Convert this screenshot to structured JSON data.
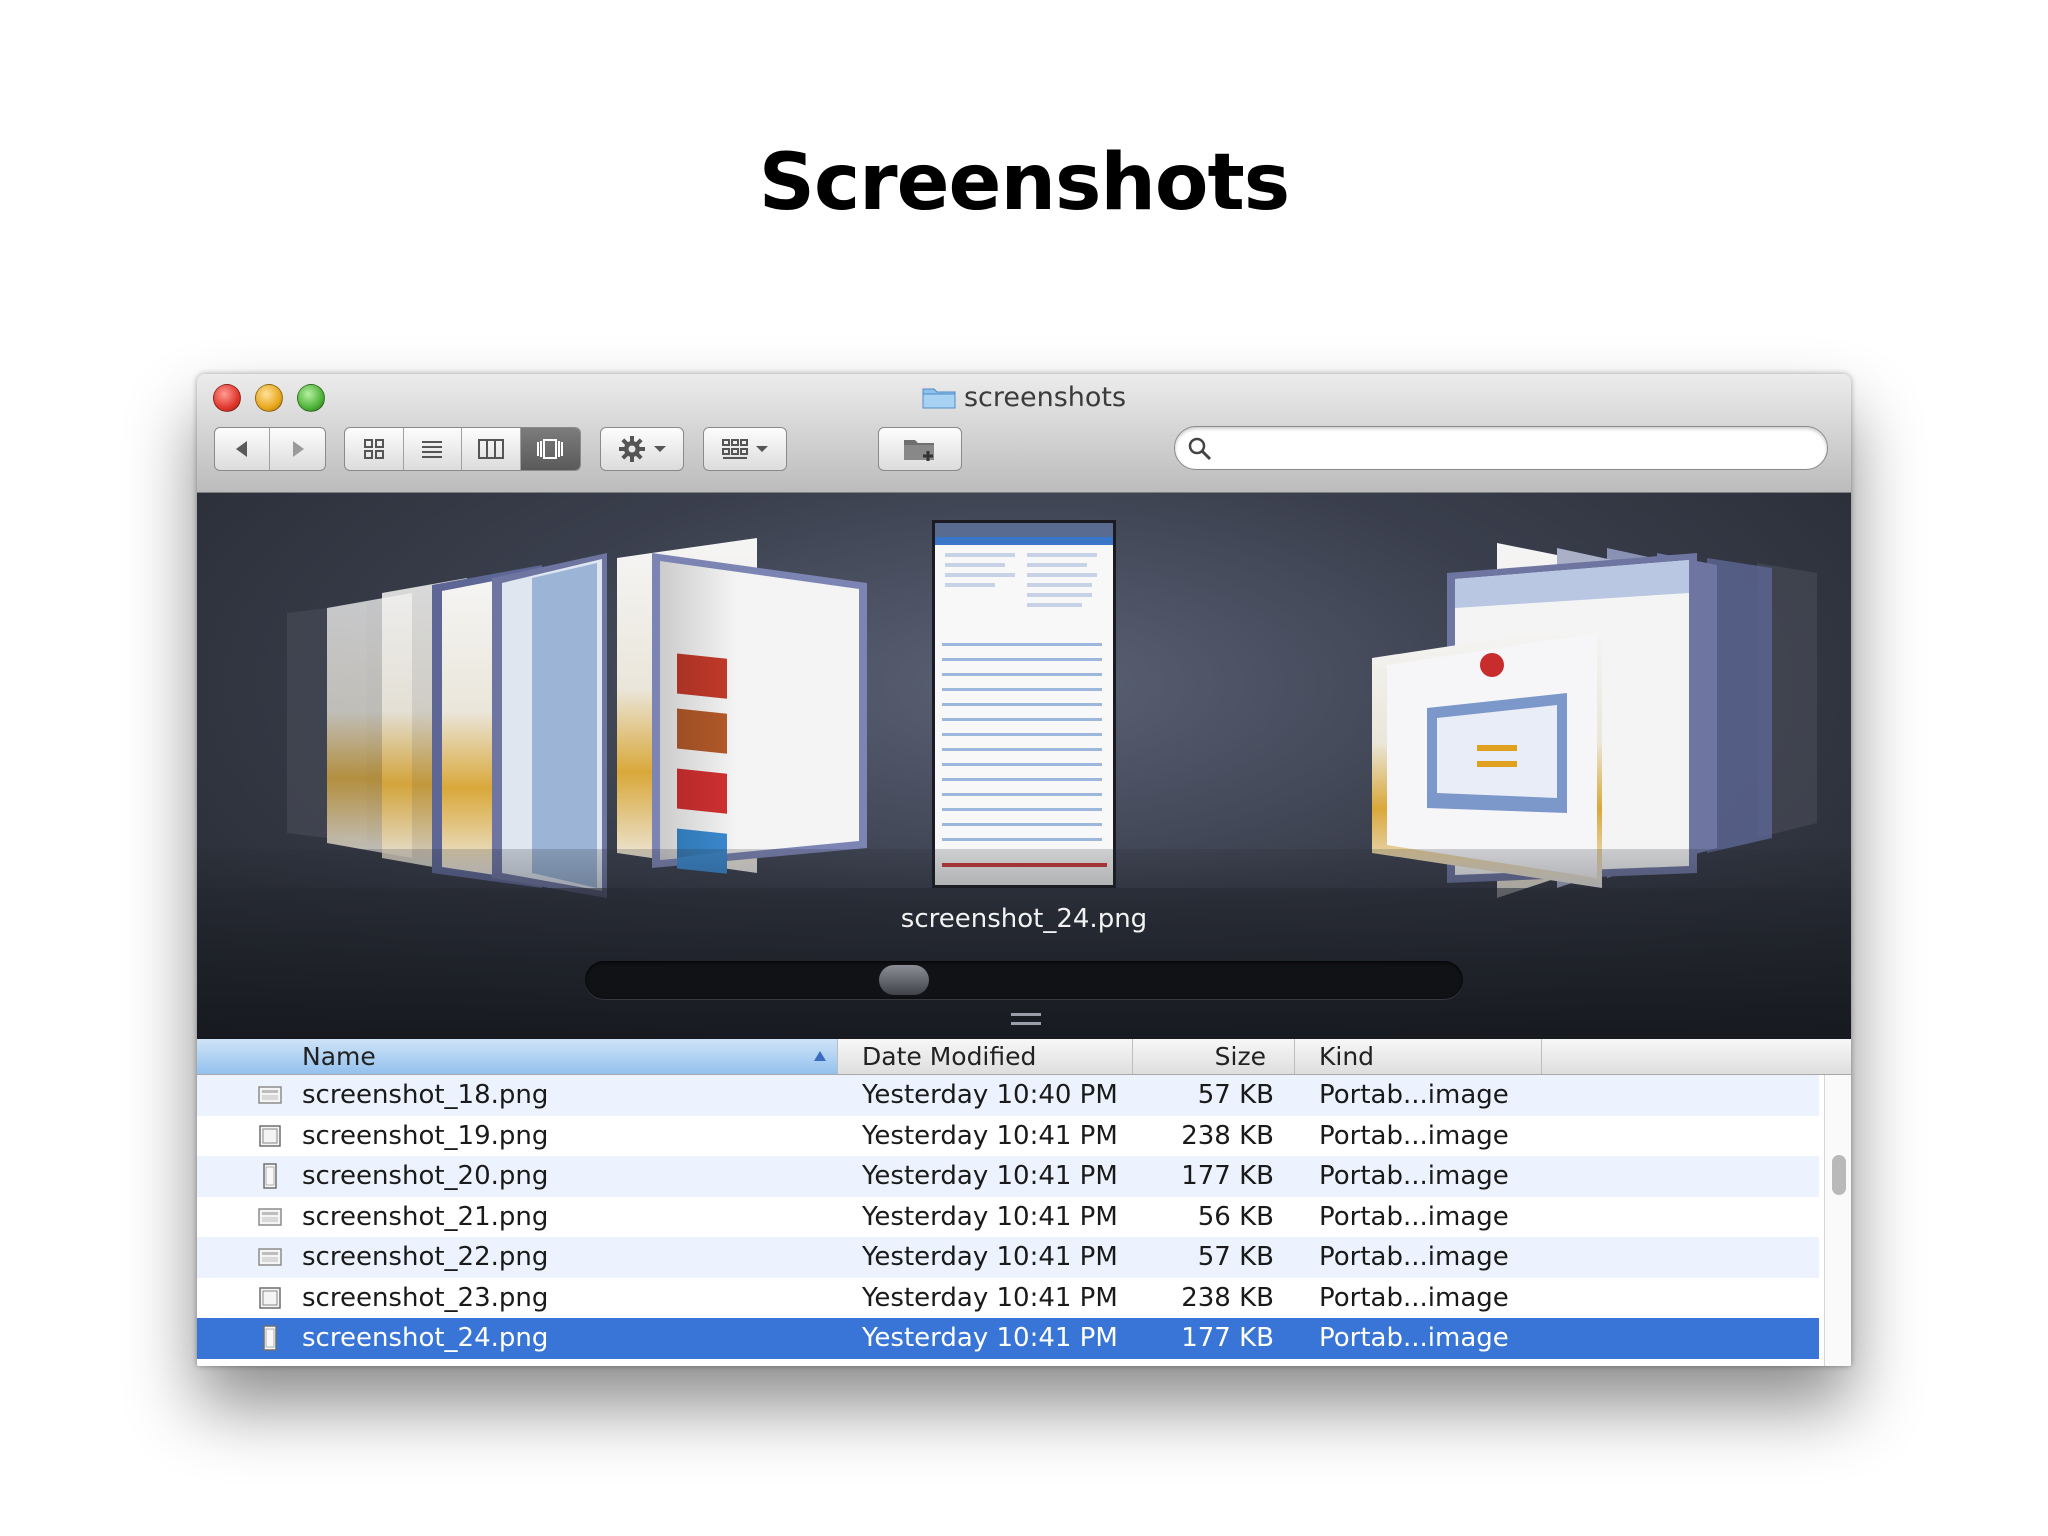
{
  "slide": {
    "title": "Screenshots"
  },
  "window": {
    "title": "screenshots",
    "search": {
      "value": "",
      "placeholder": ""
    }
  },
  "toolbar": {
    "view_modes": [
      "icon",
      "list",
      "column",
      "cover-flow"
    ],
    "active_view": "cover-flow"
  },
  "coverflow": {
    "selected_label": "screenshot_24.png",
    "scroll_position": 0.36
  },
  "columns": {
    "name": "Name",
    "date": "Date Modified",
    "size": "Size",
    "kind": "Kind",
    "sorted_by": "Name"
  },
  "files": [
    {
      "name": "screenshot_18.png",
      "date": "Yesterday 10:40 PM",
      "size": "57 KB",
      "kind": "Portab...image",
      "icon": "landscape-image-icon"
    },
    {
      "name": "screenshot_19.png",
      "date": "Yesterday 10:41 PM",
      "size": "238 KB",
      "kind": "Portab...image",
      "icon": "square-image-icon"
    },
    {
      "name": "screenshot_20.png",
      "date": "Yesterday 10:41 PM",
      "size": "177 KB",
      "kind": "Portab...image",
      "icon": "portrait-image-icon"
    },
    {
      "name": "screenshot_21.png",
      "date": "Yesterday 10:41 PM",
      "size": "56 KB",
      "kind": "Portab...image",
      "icon": "landscape-image-icon"
    },
    {
      "name": "screenshot_22.png",
      "date": "Yesterday 10:41 PM",
      "size": "57 KB",
      "kind": "Portab...image",
      "icon": "landscape-image-icon"
    },
    {
      "name": "screenshot_23.png",
      "date": "Yesterday 10:41 PM",
      "size": "238 KB",
      "kind": "Portab...image",
      "icon": "square-image-icon"
    },
    {
      "name": "screenshot_24.png",
      "date": "Yesterday 10:41 PM",
      "size": "177 KB",
      "kind": "Portab...image",
      "icon": "portrait-image-icon",
      "selected": true
    }
  ]
}
